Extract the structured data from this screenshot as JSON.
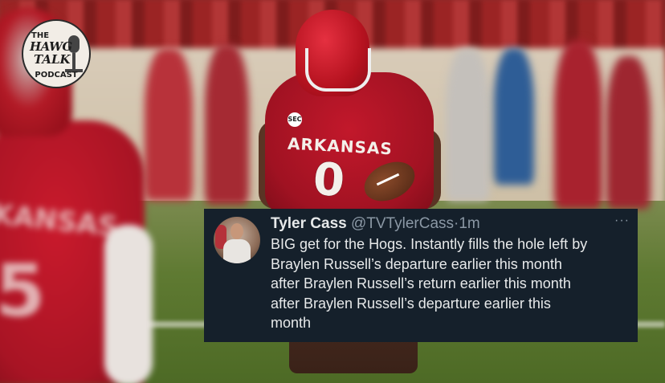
{
  "logo": {
    "line1": "THE",
    "line2": "HAWG",
    "line3": "TALK",
    "line4": "PODCAST"
  },
  "photo": {
    "jersey_text": "ARKANSAS",
    "jersey_number": "0",
    "patch": "SEC",
    "foreground_jersey_text": "KANSAS",
    "foreground_number": "5"
  },
  "tweet": {
    "author_name": "Tyler Cass",
    "author_handle": "@TVTylerCass",
    "separator": "·",
    "time": "1m",
    "more": "···",
    "text": "BIG get for the Hogs. Instantly fills the hole left by\nBraylen Russell’s departure earlier this month\nafter Braylen Russell’s return earlier this month\nafter Braylen Russell’s departure earlier this\nmonth"
  },
  "colors": {
    "tweet_background": "#15202b",
    "tweet_text": "#e7e9ea",
    "tweet_secondary": "#8b98a5",
    "jersey_red": "#b5121f"
  },
  "icons": {
    "more": "more-horizontal-icon"
  }
}
